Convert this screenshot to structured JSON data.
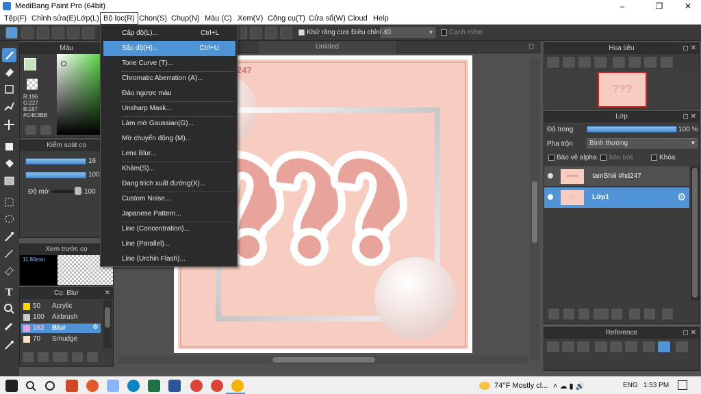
{
  "window": {
    "title": "MediBang Paint Pro (64bit)"
  },
  "menubar": {
    "items": [
      "Tệp(F)",
      "Chỉnh sửa(E)",
      "Lớp(L)",
      "Bộ lọc(R)",
      "Chọn(S)",
      "Chụp(N)",
      "Màu (C)",
      "Xem(V)",
      "Công cụ(T)",
      "Cửa sổ(W)",
      "Cloud",
      "Help"
    ]
  },
  "toolbar": {
    "antialias_label": "Khử răng cưa",
    "adjust_label": "Điều chỉnh",
    "adjust_value": "40",
    "edge_label": "Cạnh mềm"
  },
  "filter_menu": {
    "items": [
      {
        "label": "Cấp độ(L)...",
        "shortcut": "Ctrl+L"
      },
      {
        "label": "Sắc độ(H)...",
        "shortcut": "Ctrl+U"
      },
      {
        "label": "Tone Curve (T)..."
      },
      {
        "label": "Chromatic Aberration (A)..."
      },
      {
        "label": "Đảo ngược màu"
      },
      {
        "label": "Unsharp Mask..."
      },
      {
        "label": "Làm mờ Gaussian(G)..."
      },
      {
        "label": "Mờ chuyển động (M)..."
      },
      {
        "label": "Lens Blur..."
      },
      {
        "label": "Khảm(S)..."
      },
      {
        "label": "Đang trích xuất đường(X)..."
      },
      {
        "label": "Custom Noise..."
      },
      {
        "label": "Japanese Pattern..."
      },
      {
        "label": "Line (Concentration)..."
      },
      {
        "label": "Line (Parallel)..."
      },
      {
        "label": "Line (Urchin Flash)..."
      }
    ]
  },
  "color_panel": {
    "title": "Màu",
    "r": "R:196",
    "g": "G:227",
    "b": "B:187",
    "hex": "#C4E3BB"
  },
  "control_panel": {
    "title": "Kiểm soát cọ",
    "size_value": "16",
    "opacity_value": "100",
    "blur_label": "Độ mờ",
    "blur_value": "100",
    "blur_fraction": 0.9,
    "size_fraction": 0.85,
    "opacity_fraction": 0.85
  },
  "preview_panel": {
    "title": "Xem trước cọ",
    "size_text": "11.80mm"
  },
  "brush_panel": {
    "title": "Cọ: Blur",
    "items": [
      {
        "size": "50",
        "name": "Acrylic",
        "color": "#ffd700"
      },
      {
        "size": "100",
        "name": "Airbrush",
        "color": "#cccccc"
      },
      {
        "size": "162",
        "name": "Blur",
        "color": "#e5a5d8"
      },
      {
        "size": "70",
        "name": "Smudge",
        "color": "#ffe0c0"
      }
    ]
  },
  "canvas": {
    "tab_title": "Untitled",
    "partial_text": "247"
  },
  "navigator": {
    "title": "Hoa tiêu"
  },
  "layer_panel": {
    "title": "Lớp",
    "opacity_label": "Độ trong",
    "opacity_value": "100 %",
    "opacity_fraction": 1.0,
    "blend_label": "Pha trộn",
    "blend_value": "Bình thường",
    "protect_alpha": "Bảo vệ alpha",
    "clipping": "Xén bớt",
    "lock": "Khóa",
    "layers": [
      {
        "name": "IamShiii #hd247",
        "thumb": "iamshiii"
      },
      {
        "name": "Lớp1",
        "thumb": "??"
      }
    ]
  },
  "reference_panel": {
    "title": "Reference"
  },
  "taskbar": {
    "weather": "74°F  Mostly cl...",
    "lang": "ENG",
    "time": "1:53 PM"
  },
  "colors": {
    "accent": "#4e94d6",
    "canvas_bg": "#f7cdc2",
    "qmark": "#e8a49a"
  }
}
